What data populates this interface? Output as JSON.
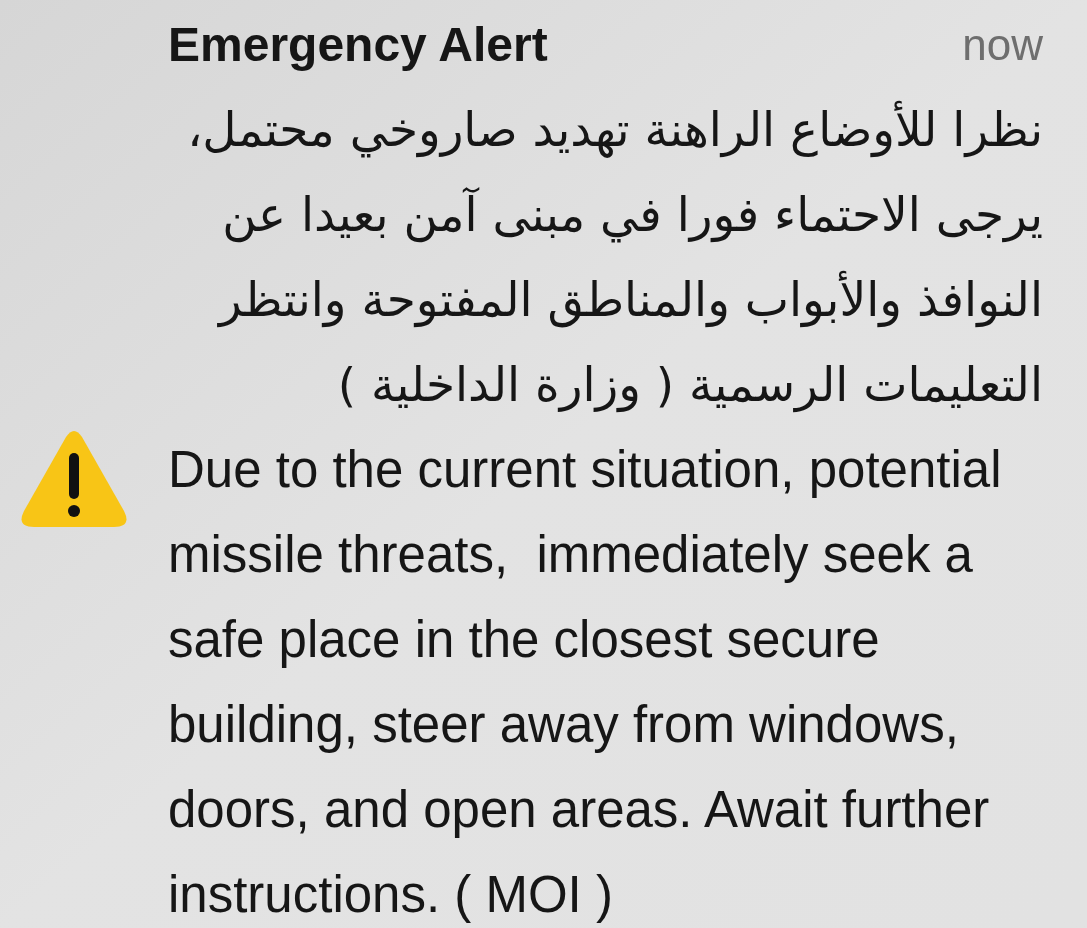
{
  "alert": {
    "title": "Emergency Alert",
    "time": "now",
    "message_arabic": "نظرا للأوضاع الراهنة تهديد صاروخي محتمل،\nيرجى الاحتماء فورا في مبنى آمن بعيدا عن\nالنوافذ والأبواب والمناطق المفتوحة وانتظر\nالتعليمات الرسمية ( وزارة الداخلية )",
    "message_english": "Due to the current situation, potential\nmissile threats,  immediately seek a\nsafe place in the closest secure\nbuilding, steer away from windows,\ndoors, and open areas. Await further\ninstructions. ( MOI )"
  }
}
